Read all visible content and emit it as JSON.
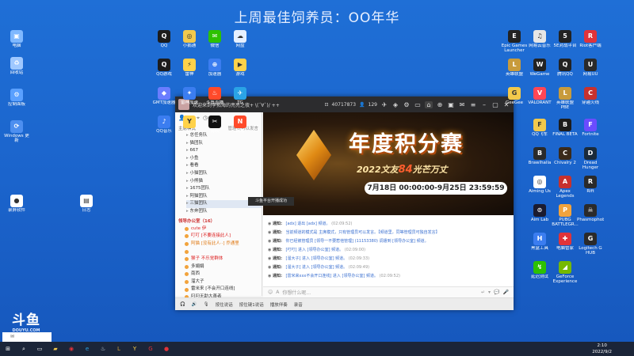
{
  "banner": {
    "title": "上周最佳饲养员：OO年华"
  },
  "desktop_left": [
    {
      "label": "电脑",
      "icon": "computer-icon",
      "color": "#7fb8ff",
      "glyph": "▣"
    },
    {
      "label": "回收站",
      "icon": "recycle-bin-icon",
      "color": "#9fc8ff",
      "glyph": "♻"
    },
    {
      "label": "控制面板",
      "icon": "control-panel-icon",
      "color": "#5aa0ff",
      "glyph": "⚙"
    },
    {
      "label": "Windows 更新",
      "icon": "windows-update-icon",
      "color": "#4d8ff0",
      "glyph": "⟳"
    },
    {
      "label": "录屏软件",
      "icon": "recorder-icon",
      "color": "#ffffff",
      "glyph": "●"
    },
    {
      "label": "日志",
      "icon": "log-icon",
      "color": "#ffffff",
      "glyph": "▤"
    }
  ],
  "desktop_middle": [
    {
      "label": "QQ",
      "icon": "qq-icon",
      "color": "#1c1c1c",
      "glyph": "Q"
    },
    {
      "label": "小鹅通",
      "icon": "app-icon",
      "color": "#f2c94c",
      "glyph": "◎"
    },
    {
      "label": "微信",
      "icon": "wechat-icon",
      "color": "#2dc100",
      "glyph": "✉"
    },
    {
      "label": "网盘",
      "icon": "cloud-drive-icon",
      "color": "#e6f0ff",
      "glyph": "☁"
    },
    {
      "label": "QQ游戏",
      "icon": "qq-game-icon",
      "color": "#1c1c1c",
      "glyph": "Q"
    },
    {
      "label": "雷神",
      "icon": "thunder-icon",
      "color": "#ffd24a",
      "glyph": "⚡"
    },
    {
      "label": "加速器",
      "icon": "accelerator-icon",
      "color": "#3b7df0",
      "glyph": "⊕"
    },
    {
      "label": "游戏",
      "icon": "game-icon",
      "color": "#ffd24a",
      "glyph": "▶"
    },
    {
      "label": "GMT加速器",
      "icon": "gmt-icon",
      "color": "#6a7dff",
      "glyph": "◆"
    },
    {
      "label": "雷神加速",
      "icon": "speedup-icon",
      "color": "#3b7df0",
      "glyph": "✦"
    },
    {
      "label": "斗鱼直播",
      "icon": "douyu-live-icon",
      "color": "#ff4a2a",
      "glyph": "♨"
    },
    {
      "label": "TG",
      "icon": "telegram-icon",
      "color": "#2aa3e6",
      "glyph": "✈"
    },
    {
      "label": "QQ音乐",
      "icon": "qq-music-icon",
      "color": "#3b7df0",
      "glyph": "♪"
    },
    {
      "label": "YY",
      "icon": "yy-icon",
      "color": "#ffd24a",
      "glyph": "Y"
    },
    {
      "label": "剪映",
      "icon": "capcut-icon",
      "color": "#111111",
      "glyph": "✂"
    },
    {
      "label": "网易",
      "icon": "netease-icon",
      "color": "#ff4a2a",
      "glyph": "N"
    }
  ],
  "desktop_right": [
    {
      "label": "Epic Games Launcher",
      "icon": "epic-games-icon",
      "color": "#222",
      "glyph": "E"
    },
    {
      "label": "网易云音乐",
      "icon": "netease-music-icon",
      "color": "#e6e6e6",
      "glyph": "♫"
    },
    {
      "label": "5E对战平台",
      "icon": "5e-platform-icon",
      "color": "#222",
      "glyph": "5"
    },
    {
      "label": "Riot客户端",
      "icon": "riot-icon",
      "color": "#e0333a",
      "glyph": "R"
    },
    {
      "label": "英雄联盟",
      "icon": "lol-icon",
      "color": "#c89b3c",
      "glyph": "L"
    },
    {
      "label": "WeGame",
      "icon": "wegame-icon",
      "color": "#222",
      "glyph": "W"
    },
    {
      "label": "腾讯QQ",
      "icon": "tencent-qq-icon",
      "color": "#222",
      "glyph": "Q"
    },
    {
      "label": "网易UU",
      "icon": "uu-icon",
      "color": "#2a2a2a",
      "glyph": "U"
    },
    {
      "label": "GeeGee",
      "icon": "geegee-icon",
      "color": "#f2c94c",
      "glyph": "G"
    },
    {
      "label": "VALORANT",
      "icon": "valorant-icon",
      "color": "#ff4655",
      "glyph": "V"
    },
    {
      "label": "英雄联盟 PBE",
      "icon": "lol-pbe-icon",
      "color": "#c89b3c",
      "glyph": "L"
    },
    {
      "label": "穿越火线",
      "icon": "cf-icon",
      "color": "#c7312e",
      "glyph": "C"
    },
    {
      "label": "QQ飞车",
      "icon": "qq-speed-icon",
      "color": "#f2c94c",
      "glyph": "F"
    },
    {
      "label": "FINAL BETA",
      "icon": "final-beta-icon",
      "color": "#1c1c1c",
      "glyph": "B"
    },
    {
      "label": "Fortnite",
      "icon": "fortnite-icon",
      "color": "#6b4cff",
      "glyph": "F"
    },
    {
      "label": "Brawlhalla",
      "icon": "brawlhalla-icon",
      "color": "#2a2a2a",
      "glyph": "B"
    },
    {
      "label": "Chivalry 2",
      "icon": "chivalry-icon",
      "color": "#3a2a1a",
      "glyph": "C"
    },
    {
      "label": "Dread Hunger",
      "icon": "dread-hunger-icon",
      "color": "#1a2a3a",
      "glyph": "D"
    },
    {
      "label": "Aiming Us",
      "icon": "aiming-icon",
      "color": "#ffffff",
      "glyph": "◎"
    },
    {
      "label": "Apex Legends",
      "icon": "apex-icon",
      "color": "#c7312e",
      "glyph": "A"
    },
    {
      "label": "Rift",
      "icon": "rift-icon",
      "color": "#2a2a2a",
      "glyph": "R"
    },
    {
      "label": "Aim Lab",
      "icon": "aimlab-icon",
      "color": "#1b1b2f",
      "glyph": "⊙"
    },
    {
      "label": "PUBG BATTLEGR...",
      "icon": "pubg-icon",
      "color": "#f2a33c",
      "glyph": "P"
    },
    {
      "label": "Phasmophobia",
      "icon": "phasmophobia-icon",
      "color": "#2a2a2a",
      "glyph": "☠"
    },
    {
      "label": "黑盒工具",
      "icon": "heybox-icon",
      "color": "#3b7df0",
      "glyph": "H"
    },
    {
      "label": "电脑管家",
      "icon": "pc-manager-icon",
      "color": "#e0333a",
      "glyph": "✚"
    },
    {
      "label": "Logitech G HUB",
      "icon": "ghub-icon",
      "color": "#2a2a2a",
      "glyph": "G"
    },
    {
      "label": "延迟测试",
      "icon": "ping-test-icon",
      "color": "#2dc100",
      "glyph": "↯"
    },
    {
      "label": "GeForce Experience",
      "icon": "geforce-icon",
      "color": "#76b900",
      "glyph": "◢"
    }
  ],
  "window": {
    "title": "欢迎来到李拓海的亮亮之夜+ \\(ˊ∀ˋ)/ ++",
    "id_count": "40717873",
    "user_count": "129"
  },
  "sidebar": {
    "mode_label": "主席模式",
    "manage_label": "管理员可以发言",
    "channels": [
      "总任务队",
      "猫团队",
      "667",
      "小鱼",
      "看看",
      "小猫团队",
      "小熊猫",
      "1675团队",
      "阿猫团队",
      "三猫团队",
      "东奔团队"
    ],
    "room_title": "领导办公室（16）",
    "users": [
      {
        "name": "cute 伊",
        "style": "red"
      },
      {
        "name": "叮叮 [不要连接此人]",
        "style": "red"
      },
      {
        "name": "阿猫 [没有此人··] 乔通里",
        "style": "orange"
      },
      {
        "name": "",
        "style": "plain"
      },
      {
        "name": "猴子 不乐觉群体",
        "style": "red"
      },
      {
        "name": "多娟娟 ",
        "style": "plain"
      },
      {
        "name": "南西 ",
        "style": "plain"
      },
      {
        "name": "溜大子 ",
        "style": "plain"
      },
      {
        "name": "雷米来 [不会开口连线]",
        "style": "plain"
      },
      {
        "name": "叼叼无助大善者 ",
        "style": "plain"
      },
      {
        "name": "龙喵 ",
        "style": "plain"
      }
    ]
  },
  "tooltip": "斗鱼平台开播成功",
  "promo": {
    "title": "年度积分赛",
    "subtitle_pre": "2022文友",
    "subtitle_hi": "84",
    "subtitle_post": "光芒万丈",
    "dates": "7月18日 00:00:00-9月25日 23:59:59"
  },
  "messages": [
    {
      "sys": "通知:",
      "body": "[adx] 退出 [adx] 频道。",
      "time": "(02:09:52)"
    },
    {
      "sys": "通知:",
      "body": "当前频道的模式是 主席模式，只有管理员可以发言。【频道里，同等管理员可独自发言】",
      "time": ""
    },
    {
      "sys": "通知:",
      "body": "你已经被管理员 [领导一不要惹他管理] (11153380) 调遣到 [领导办公室] 频道。",
      "time": ""
    },
    {
      "sys": "通知:",
      "body": "[叮叮] 进入 [领导办公室] 频道。",
      "time": "(02:09:00)"
    },
    {
      "sys": "通知:",
      "body": "[溜大子] 进入 [领导办公室] 频道。",
      "time": "(02:09:33)"
    },
    {
      "sys": "通知:",
      "body": "[溜大子] 进入 [领导办公室] 频道。",
      "time": "(02:09:49)"
    },
    {
      "sys": "通知:",
      "body": "[雷米来xxx不会开口连线] 进入 [领导办公室] 频道。",
      "time": "(02:09:52)"
    }
  ],
  "input": {
    "placeholder": "你想什么呢..."
  },
  "bottom": {
    "mic": "按住说话",
    "queue": "按住键1说话",
    "record": "播放伴奏",
    "rec2": "录音"
  },
  "douyu": {
    "logo": "斗鱼",
    "url": "DOUYU.COM",
    "room": "2897373"
  },
  "taskbar": {
    "time": "2:10",
    "date": "2022/9/2",
    "apps": [
      {
        "icon": "start-icon",
        "glyph": "⊞",
        "color": "#ffffff"
      },
      {
        "icon": "search-icon",
        "glyph": "⌕",
        "color": "#ffffff"
      },
      {
        "icon": "task-view-icon",
        "glyph": "▭",
        "color": "#ffffff"
      },
      {
        "icon": "file-explorer-icon",
        "glyph": "▰",
        "color": "#f2c94c"
      },
      {
        "icon": "browser-icon",
        "glyph": "◉",
        "color": "#e0333a"
      },
      {
        "icon": "edge-icon",
        "glyph": "e",
        "color": "#2aa3e6"
      },
      {
        "icon": "steam-icon",
        "glyph": "♨",
        "color": "#c7d5e0"
      },
      {
        "icon": "lol-taskbar-icon",
        "glyph": "L",
        "color": "#c89b3c"
      },
      {
        "icon": "yy-taskbar-icon",
        "glyph": "Y",
        "color": "#ffd24a"
      },
      {
        "icon": "g-icon",
        "glyph": "G",
        "color": "#e0333a"
      },
      {
        "icon": "record-icon",
        "glyph": "●",
        "color": "#e0333a"
      }
    ]
  }
}
